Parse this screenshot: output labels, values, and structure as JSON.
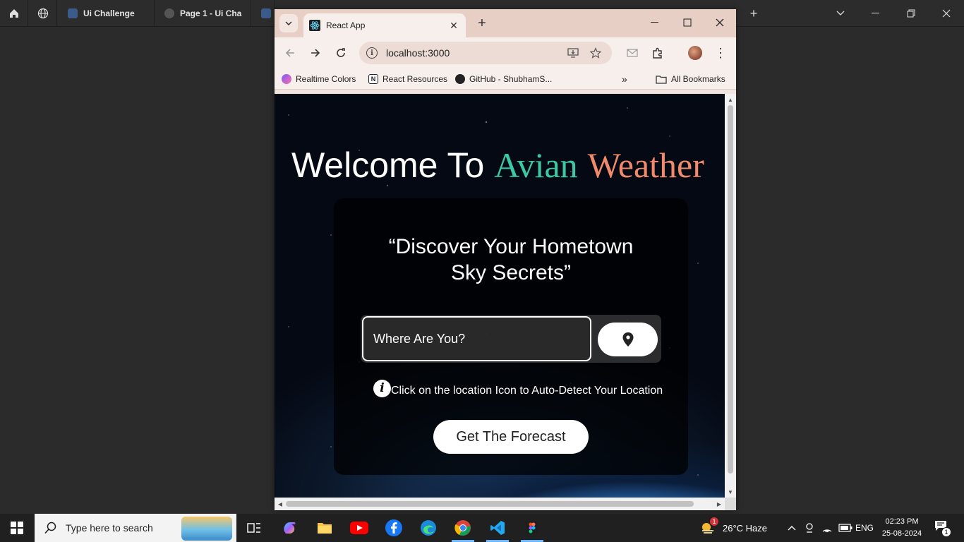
{
  "bg_app": {
    "tabs": [
      "Ui Challenge",
      "Page 1 - Ui Cha"
    ]
  },
  "browser": {
    "tab_title": "React App",
    "url": "localhost:3000",
    "bookmarks": [
      "Realtime Colors",
      "React Resources",
      "GitHub - ShubhamS...",
      "All Bookmarks"
    ]
  },
  "page": {
    "welcome_prefix": "Welcome To",
    "brand_first": "Avian",
    "brand_second": "Weather",
    "quote_line1": "“Discover Your Hometown",
    "quote_line2": "Sky Secrets”",
    "search_placeholder": "Where Are You?",
    "hint": "Click on the location Icon to Auto-Detect Your Location",
    "forecast_button": "Get The Forecast",
    "colors": {
      "avian": "#3cc7a6",
      "weather": "#f08a6a"
    }
  },
  "taskbar": {
    "search_placeholder": "Type here to search",
    "weather": "26°C  Haze",
    "language": "ENG",
    "time": "02:23 PM",
    "date": "25-08-2024",
    "notification_count": "1",
    "weather_badge": "1"
  }
}
